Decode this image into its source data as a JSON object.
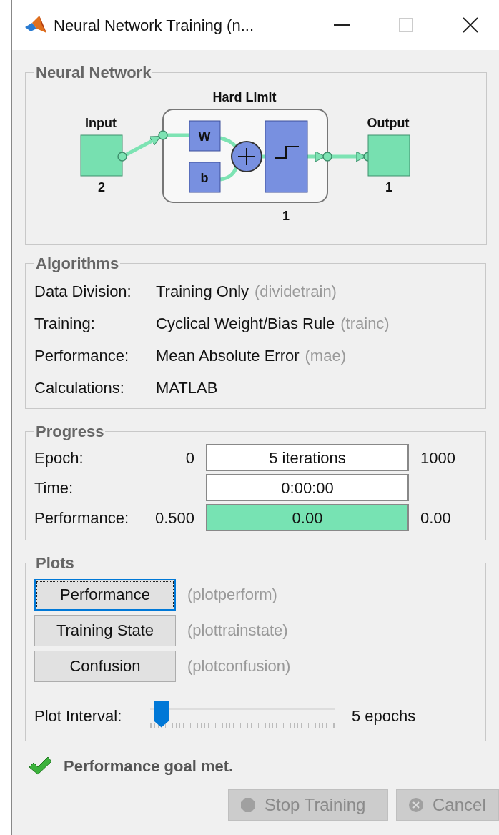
{
  "window": {
    "title": "Neural Network Training (n..."
  },
  "network": {
    "legend": "Neural Network",
    "input_label": "Input",
    "input_size": "2",
    "layer_label": "Hard Limit",
    "weight_label": "W",
    "bias_label": "b",
    "layer_size": "1",
    "output_label": "Output",
    "output_size": "1"
  },
  "algorithms": {
    "legend": "Algorithms",
    "rows": [
      {
        "label": "Data Division:",
        "value": "Training Only",
        "hint": "(dividetrain)"
      },
      {
        "label": "Training:",
        "value": "Cyclical Weight/Bias Rule",
        "hint": "(trainc)"
      },
      {
        "label": "Performance:",
        "value": "Mean Absolute Error",
        "hint": "(mae)"
      },
      {
        "label": "Calculations:",
        "value": "MATLAB"
      }
    ]
  },
  "progress": {
    "legend": "Progress",
    "rows": [
      {
        "label": "Epoch:",
        "start": "0",
        "value": "5 iterations",
        "end": "1000"
      },
      {
        "label": "Time:",
        "value": "0:00:00"
      },
      {
        "label": "Performance:",
        "start": "0.500",
        "value": "0.00",
        "end": "0.00",
        "level": 1
      }
    ]
  },
  "plots": {
    "legend": "Plots",
    "buttons": [
      {
        "label": "Performance",
        "hint": "(plotperform)",
        "focused": true
      },
      {
        "label": "Training State",
        "hint": "(plottrainstate)",
        "focused": false
      },
      {
        "label": "Confusion",
        "hint": "(plotconfusion)",
        "focused": false
      }
    ],
    "interval": {
      "label": "Plot Interval:",
      "level": 0.02,
      "reading": "5 epochs"
    }
  },
  "status": "Performance goal met.",
  "buttons": [
    {
      "label": "Stop Training",
      "kind": "stop",
      "disabled": true
    },
    {
      "label": "Cancel",
      "kind": "cancel",
      "disabled": true
    }
  ]
}
